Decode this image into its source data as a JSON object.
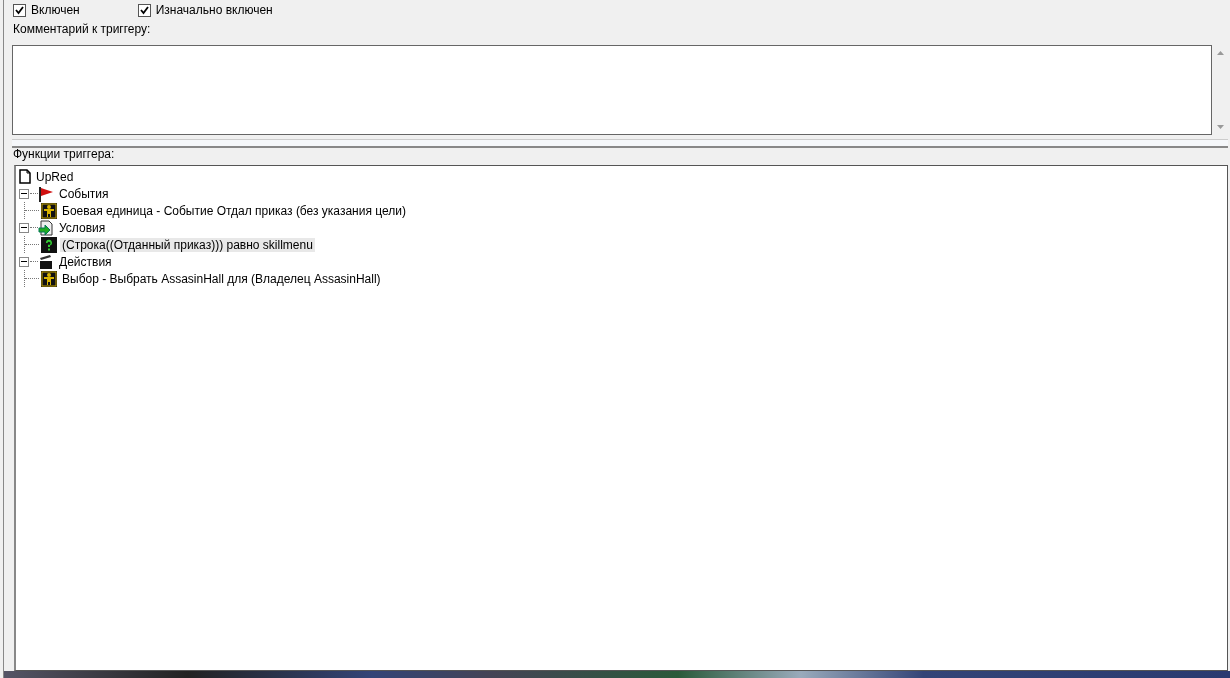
{
  "options": [
    {
      "label": "Включен",
      "checked": true
    },
    {
      "label": "Изначально включен",
      "checked": true
    }
  ],
  "comment": {
    "label": "Комментарий к триггеру:"
  },
  "functions": {
    "label": "Функции триггера:",
    "tree": {
      "label": "UpRed",
      "kind": "trigger",
      "selected": false,
      "children": [
        {
          "label": "События",
          "kind": "events",
          "expanded": true,
          "selected": false,
          "children": [
            {
              "label": "Боевая единица - Событие Отдал приказ (без указания цели)",
              "kind": "unit",
              "selected": false
            }
          ]
        },
        {
          "label": "Условия",
          "kind": "conditions",
          "expanded": true,
          "selected": false,
          "children": [
            {
              "label": "(Строка((Отданный приказ))) равно skillmenu",
              "kind": "question",
              "selected": true
            }
          ]
        },
        {
          "label": "Действия",
          "kind": "actions",
          "expanded": true,
          "selected": false,
          "children": [
            {
              "label": "Выбор - Выбрать AssasinHall для (Владелец AssasinHall)",
              "kind": "unit",
              "selected": false
            }
          ]
        }
      ]
    }
  }
}
